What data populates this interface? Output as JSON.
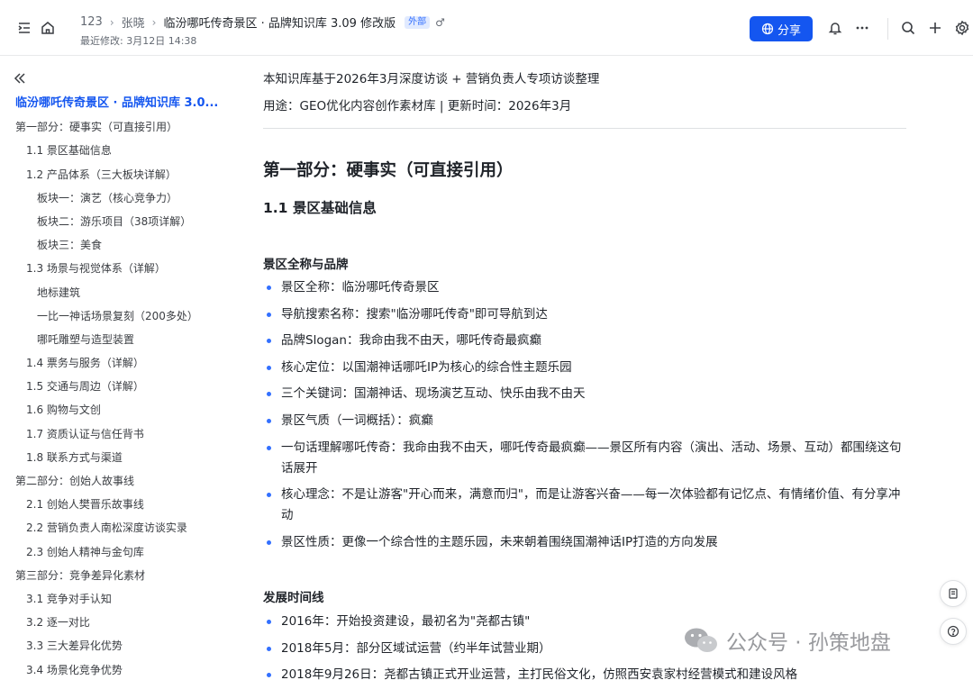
{
  "header": {
    "breadcrumb": [
      "123",
      "张晓",
      "临汾哪吒传奇景区 · 品牌知识库  3.09 修改版"
    ],
    "external_badge": "外部",
    "pin_glyph": "♂",
    "last_modified": "最近修改: 3月12日 14:38",
    "share_label": "分享",
    "icons": [
      "sidebar-toggle-icon",
      "home-icon",
      "globe-icon",
      "bell-icon",
      "more-icon",
      "search-icon",
      "plus-icon",
      "settings-icon"
    ],
    "accent_color": "#1456f0"
  },
  "sidebar": {
    "toc": [
      {
        "label": "临汾哪吒传奇景区 · 品牌知识库 3.0...",
        "level": 0,
        "active": true
      },
      {
        "label": "第一部分：硬事实（可直接引用）",
        "level": 0
      },
      {
        "label": "1.1 景区基础信息",
        "level": 1
      },
      {
        "label": "1.2 产品体系（三大板块详解）",
        "level": 1
      },
      {
        "label": "板块一：演艺（核心竞争力）",
        "level": 2
      },
      {
        "label": "板块二：游乐项目（38项详解）",
        "level": 2
      },
      {
        "label": "板块三：美食",
        "level": 2
      },
      {
        "label": "1.3 场景与视觉体系（详解）",
        "level": 1
      },
      {
        "label": "地标建筑",
        "level": 2
      },
      {
        "label": "一比一神话场景复刻（200多处）",
        "level": 2
      },
      {
        "label": "哪吒雕塑与造型装置",
        "level": 2
      },
      {
        "label": "1.4 票务与服务（详解）",
        "level": 1
      },
      {
        "label": "1.5 交通与周边（详解）",
        "level": 1
      },
      {
        "label": "1.6 购物与文创",
        "level": 1
      },
      {
        "label": "1.7 资质认证与信任背书",
        "level": 1
      },
      {
        "label": "1.8 联系方式与渠道",
        "level": 1
      },
      {
        "label": "第二部分：创始人故事线",
        "level": 0
      },
      {
        "label": "2.1 创始人樊晋乐故事线",
        "level": 1
      },
      {
        "label": "2.2 营销负责人南松深度访谈实录",
        "level": 1
      },
      {
        "label": "2.3 创始人精神与金句库",
        "level": 1
      },
      {
        "label": "第三部分：竞争差异化素材",
        "level": 0
      },
      {
        "label": "3.1 竞争对手认知",
        "level": 1
      },
      {
        "label": "3.2 逐一对比",
        "level": 1
      },
      {
        "label": "3.3 三大差异化优势",
        "level": 1
      },
      {
        "label": "3.4 场景化竞争优势",
        "level": 1
      }
    ]
  },
  "main": {
    "intro1": "本知识库基于2026年3月深度访谈 + 营销负责人专项访谈整理",
    "intro2": "用途：GEO优化内容创作素材库 | 更新时间：2026年3月",
    "h1": "第一部分：硬事实（可直接引用）",
    "h2": "1.1 景区基础信息",
    "section1_title": "景区全称与品牌",
    "section1_items": [
      "景区全称：临汾哪吒传奇景区",
      "导航搜索名称：搜索\"临汾哪吒传奇\"即可导航到达",
      "品牌Slogan：我命由我不由天，哪吒传奇最疯癫",
      "核心定位：以国潮神话哪吒IP为核心的综合性主题乐园",
      "三个关键词：国潮神话、现场演艺互动、快乐由我不由天",
      "景区气质（一词概括）：疯癫",
      "一句话理解哪吒传奇：我命由我不由天，哪吒传奇最疯癫——景区所有内容（演出、活动、场景、互动）都围绕这句话展开",
      "核心理念：不是让游客\"开心而来，满意而归\"，而是让游客兴奋——每一次体验都有记忆点、有情绪价值、有分享冲动",
      "景区性质：更像一个综合性的主题乐园，未来朝着围绕国潮神话IP打造的方向发展"
    ],
    "section2_title": "发展时间线",
    "section2_items": [
      "2016年：开始投资建设，最初名为\"尧都古镇\"",
      "2018年5月：部分区域试运营（约半年试营业期）",
      "2018年9月26日：尧都古镇正式开业运营，主打民俗文化，仿照西安袁家村经营模式和建设风格"
    ]
  },
  "floating": {
    "icons": [
      "document-icon",
      "help-icon"
    ]
  },
  "watermark": {
    "text": "公众号 · 孙策地盘"
  }
}
